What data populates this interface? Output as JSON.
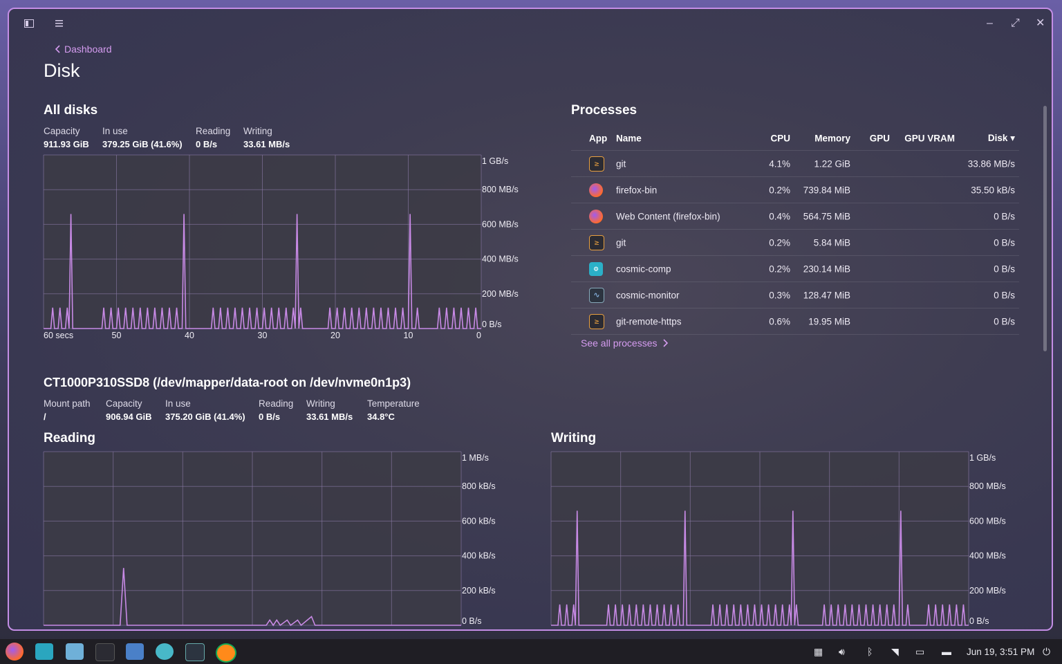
{
  "header": {
    "back_label": "Dashboard",
    "title": "Disk"
  },
  "all_disks": {
    "title": "All disks",
    "stats": [
      {
        "label": "Capacity",
        "value": "911.93 GiB"
      },
      {
        "label": "In use",
        "value": "379.25 GiB (41.6%)"
      },
      {
        "label": "Reading",
        "value": "0 B/s"
      },
      {
        "label": "Writing",
        "value": "33.61 MB/s"
      }
    ],
    "y_ticks": [
      "1 GB/s",
      "800 MB/s",
      "600 MB/s",
      "400 MB/s",
      "200 MB/s",
      "0 B/s"
    ],
    "x_ticks": [
      "60 secs",
      "50",
      "40",
      "30",
      "20",
      "10",
      "0"
    ]
  },
  "processes": {
    "title": "Processes",
    "columns": {
      "app": "App",
      "name": "Name",
      "cpu": "CPU",
      "memory": "Memory",
      "gpu": "GPU",
      "gpu_vram": "GPU VRAM",
      "disk": "Disk"
    },
    "rows": [
      {
        "icon": "terminal-icon",
        "name": "git",
        "cpu": "4.1%",
        "memory": "1.22 GiB",
        "gpu": "",
        "gpu_vram": "",
        "disk": "33.86 MB/s"
      },
      {
        "icon": "firefox-icon",
        "name": "firefox-bin",
        "cpu": "0.2%",
        "memory": "739.84 MiB",
        "gpu": "",
        "gpu_vram": "",
        "disk": "35.50 kB/s"
      },
      {
        "icon": "firefox-icon",
        "name": "Web Content (firefox-bin)",
        "cpu": "0.4%",
        "memory": "564.75 MiB",
        "gpu": "",
        "gpu_vram": "",
        "disk": "0 B/s"
      },
      {
        "icon": "terminal-icon",
        "name": "git",
        "cpu": "0.2%",
        "memory": "5.84 MiB",
        "gpu": "",
        "gpu_vram": "",
        "disk": "0 B/s"
      },
      {
        "icon": "settings-icon",
        "name": "cosmic-comp",
        "cpu": "0.2%",
        "memory": "230.14 MiB",
        "gpu": "",
        "gpu_vram": "",
        "disk": "0 B/s"
      },
      {
        "icon": "monitor-icon",
        "name": "cosmic-monitor",
        "cpu": "0.3%",
        "memory": "128.47 MiB",
        "gpu": "",
        "gpu_vram": "",
        "disk": "0 B/s"
      },
      {
        "icon": "terminal-icon",
        "name": "git-remote-https",
        "cpu": "0.6%",
        "memory": "19.95 MiB",
        "gpu": "",
        "gpu_vram": "",
        "disk": "0 B/s"
      }
    ],
    "see_all": "See all processes"
  },
  "device": {
    "title": "CT1000P310SSD8 (/dev/mapper/data-root on /dev/nvme0n1p3)",
    "stats": [
      {
        "label": "Mount path",
        "value": "/"
      },
      {
        "label": "Capacity",
        "value": "906.94 GiB"
      },
      {
        "label": "In use",
        "value": "375.20 GiB (41.4%)"
      },
      {
        "label": "Reading",
        "value": "0 B/s"
      },
      {
        "label": "Writing",
        "value": "33.61 MB/s"
      },
      {
        "label": "Temperature",
        "value": "34.8°C"
      }
    ]
  },
  "reading": {
    "title": "Reading",
    "y_ticks": [
      "1 MB/s",
      "800 kB/s",
      "600 kB/s",
      "400 kB/s",
      "200 kB/s",
      "0 B/s"
    ]
  },
  "writing": {
    "title": "Writing",
    "y_ticks": [
      "1 GB/s",
      "800 MB/s",
      "600 MB/s",
      "400 MB/s",
      "200 MB/s",
      "0 B/s"
    ]
  },
  "taskbar": {
    "clock": "Jun 19, 3:51 PM"
  },
  "colors": {
    "accent": "#d59cf0",
    "line": "#c88ae6",
    "chart_bg": "#3c3b45"
  }
}
